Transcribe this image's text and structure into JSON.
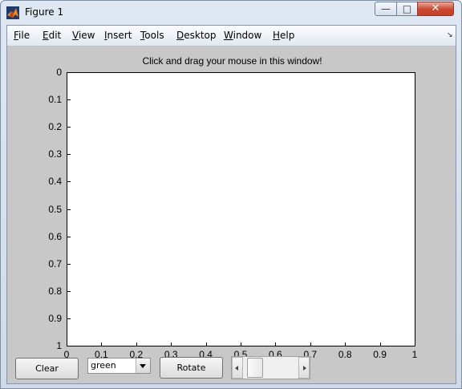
{
  "window": {
    "title": "Figure 1",
    "minimize_glyph": "—",
    "maximize_glyph": "□",
    "close_glyph": "✕",
    "app_icon": "matlab-icon"
  },
  "menubar": {
    "items": [
      {
        "label": "File",
        "key": "F",
        "rest": "ile"
      },
      {
        "label": "Edit",
        "key": "E",
        "rest": "dit"
      },
      {
        "label": "View",
        "key": "V",
        "rest": "iew"
      },
      {
        "label": "Insert",
        "key": "I",
        "rest": "nsert"
      },
      {
        "label": "Tools",
        "key": "T",
        "rest": "ools"
      },
      {
        "label": "Desktop",
        "key": "D",
        "rest": "esktop"
      },
      {
        "label": "Window",
        "key": "W",
        "rest": "indow"
      },
      {
        "label": "Help",
        "key": "H",
        "rest": "elp"
      }
    ],
    "dock_glyph": "↘"
  },
  "axes": {
    "title": "Click and drag your mouse in this window!",
    "yticks": [
      "0",
      "0.1",
      "0.2",
      "0.3",
      "0.4",
      "0.5",
      "0.6",
      "0.7",
      "0.8",
      "0.9",
      "1"
    ],
    "xticks": [
      "0",
      "0.1",
      "0.2",
      "0.3",
      "0.4",
      "0.5",
      "0.6",
      "0.7",
      "0.8",
      "0.9",
      "1"
    ],
    "ylim": [
      0,
      1
    ],
    "xlim": [
      0,
      1
    ],
    "y_direction": "reversed"
  },
  "controls": {
    "clear_label": "Clear",
    "color_select_value": "green",
    "rotate_label": "Rotate",
    "slider_value": 0.1
  }
}
